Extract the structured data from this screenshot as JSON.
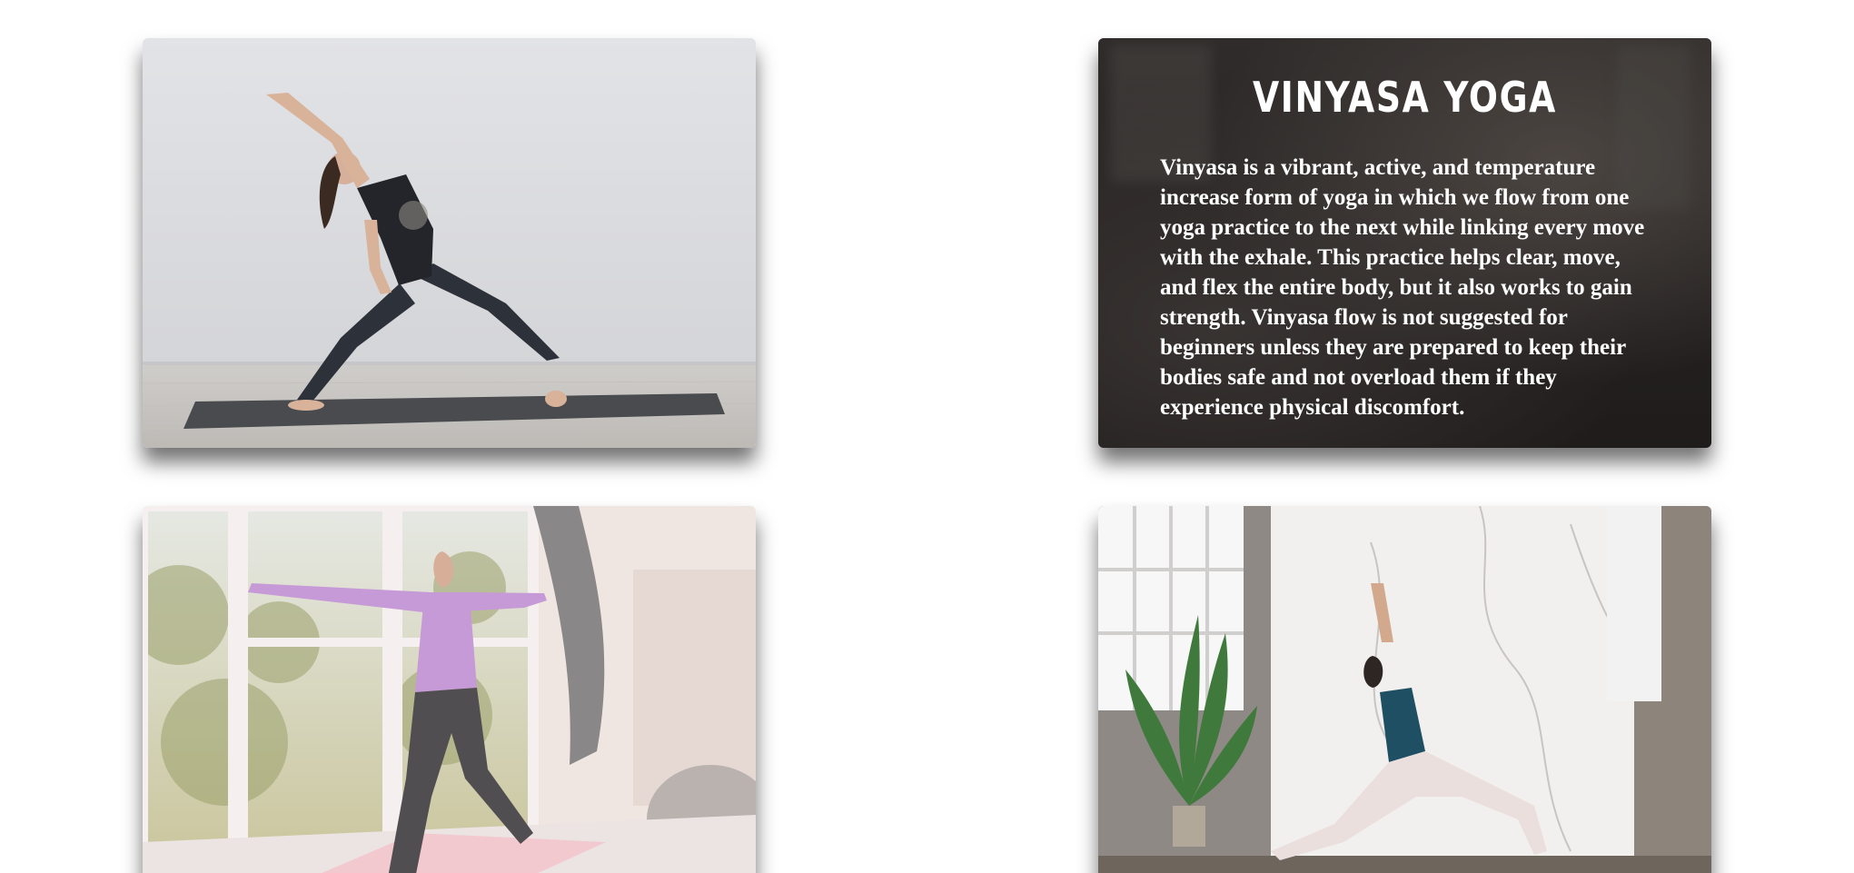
{
  "cards": [
    {
      "kind": "photo",
      "subject": "woman in black tank top doing extended side angle pose on grey mat in bright white studio"
    },
    {
      "kind": "text",
      "title": "VINYASA YOGA",
      "body": "Vinyasa is a vibrant, active, and temperature increase form of yoga in which we flow from one yoga practice to the next while linking every move with the exhale. This practice helps clear, move, and flex the entire body, but it also works to gain strength. Vinyasa flow is not suggested for beginners unless they are prepared to keep their bodies safe and not overload them if they experience physical discomfort."
    },
    {
      "kind": "photo",
      "subject": "woman in lilac top doing warrior II pose on pink mat by large windows"
    },
    {
      "kind": "photo",
      "subject": "woman in teal sports bra and white leggings doing low lunge with arm raised in marble room with plant"
    }
  ],
  "colors": {
    "page_background": "#ffffff",
    "text_card_overlay": "#2f2b2a",
    "text_color": "#ffffff"
  }
}
